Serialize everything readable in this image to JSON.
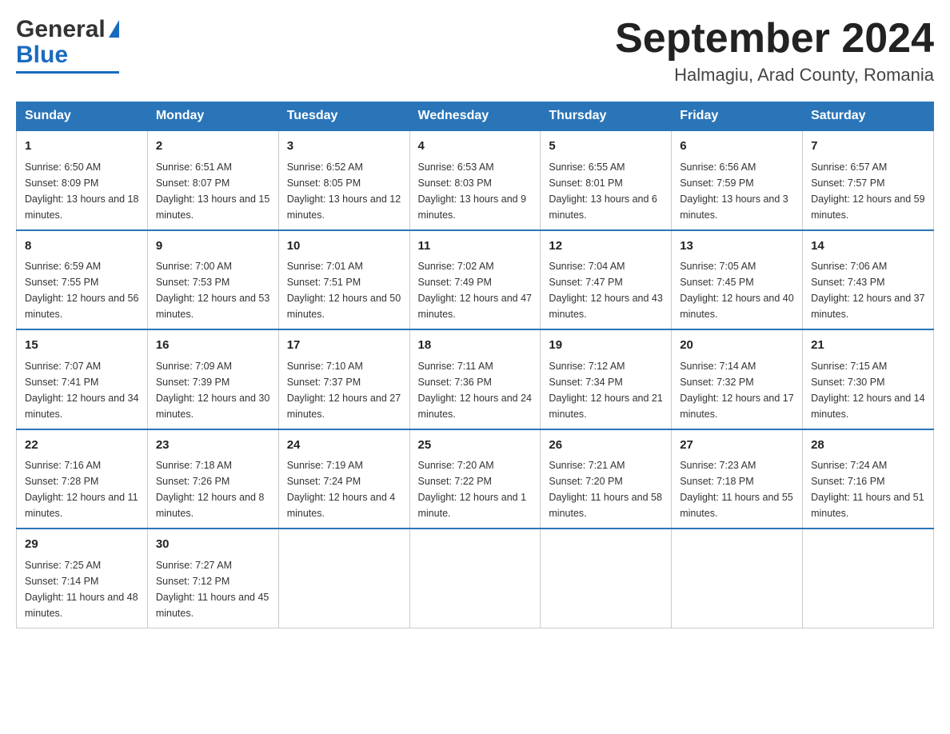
{
  "header": {
    "logo_general": "General",
    "logo_blue": "Blue",
    "title": "September 2024",
    "subtitle": "Halmagiu, Arad County, Romania"
  },
  "weekdays": [
    "Sunday",
    "Monday",
    "Tuesday",
    "Wednesday",
    "Thursday",
    "Friday",
    "Saturday"
  ],
  "weeks": [
    [
      {
        "day": "1",
        "sunrise": "Sunrise: 6:50 AM",
        "sunset": "Sunset: 8:09 PM",
        "daylight": "Daylight: 13 hours and 18 minutes."
      },
      {
        "day": "2",
        "sunrise": "Sunrise: 6:51 AM",
        "sunset": "Sunset: 8:07 PM",
        "daylight": "Daylight: 13 hours and 15 minutes."
      },
      {
        "day": "3",
        "sunrise": "Sunrise: 6:52 AM",
        "sunset": "Sunset: 8:05 PM",
        "daylight": "Daylight: 13 hours and 12 minutes."
      },
      {
        "day": "4",
        "sunrise": "Sunrise: 6:53 AM",
        "sunset": "Sunset: 8:03 PM",
        "daylight": "Daylight: 13 hours and 9 minutes."
      },
      {
        "day": "5",
        "sunrise": "Sunrise: 6:55 AM",
        "sunset": "Sunset: 8:01 PM",
        "daylight": "Daylight: 13 hours and 6 minutes."
      },
      {
        "day": "6",
        "sunrise": "Sunrise: 6:56 AM",
        "sunset": "Sunset: 7:59 PM",
        "daylight": "Daylight: 13 hours and 3 minutes."
      },
      {
        "day": "7",
        "sunrise": "Sunrise: 6:57 AM",
        "sunset": "Sunset: 7:57 PM",
        "daylight": "Daylight: 12 hours and 59 minutes."
      }
    ],
    [
      {
        "day": "8",
        "sunrise": "Sunrise: 6:59 AM",
        "sunset": "Sunset: 7:55 PM",
        "daylight": "Daylight: 12 hours and 56 minutes."
      },
      {
        "day": "9",
        "sunrise": "Sunrise: 7:00 AM",
        "sunset": "Sunset: 7:53 PM",
        "daylight": "Daylight: 12 hours and 53 minutes."
      },
      {
        "day": "10",
        "sunrise": "Sunrise: 7:01 AM",
        "sunset": "Sunset: 7:51 PM",
        "daylight": "Daylight: 12 hours and 50 minutes."
      },
      {
        "day": "11",
        "sunrise": "Sunrise: 7:02 AM",
        "sunset": "Sunset: 7:49 PM",
        "daylight": "Daylight: 12 hours and 47 minutes."
      },
      {
        "day": "12",
        "sunrise": "Sunrise: 7:04 AM",
        "sunset": "Sunset: 7:47 PM",
        "daylight": "Daylight: 12 hours and 43 minutes."
      },
      {
        "day": "13",
        "sunrise": "Sunrise: 7:05 AM",
        "sunset": "Sunset: 7:45 PM",
        "daylight": "Daylight: 12 hours and 40 minutes."
      },
      {
        "day": "14",
        "sunrise": "Sunrise: 7:06 AM",
        "sunset": "Sunset: 7:43 PM",
        "daylight": "Daylight: 12 hours and 37 minutes."
      }
    ],
    [
      {
        "day": "15",
        "sunrise": "Sunrise: 7:07 AM",
        "sunset": "Sunset: 7:41 PM",
        "daylight": "Daylight: 12 hours and 34 minutes."
      },
      {
        "day": "16",
        "sunrise": "Sunrise: 7:09 AM",
        "sunset": "Sunset: 7:39 PM",
        "daylight": "Daylight: 12 hours and 30 minutes."
      },
      {
        "day": "17",
        "sunrise": "Sunrise: 7:10 AM",
        "sunset": "Sunset: 7:37 PM",
        "daylight": "Daylight: 12 hours and 27 minutes."
      },
      {
        "day": "18",
        "sunrise": "Sunrise: 7:11 AM",
        "sunset": "Sunset: 7:36 PM",
        "daylight": "Daylight: 12 hours and 24 minutes."
      },
      {
        "day": "19",
        "sunrise": "Sunrise: 7:12 AM",
        "sunset": "Sunset: 7:34 PM",
        "daylight": "Daylight: 12 hours and 21 minutes."
      },
      {
        "day": "20",
        "sunrise": "Sunrise: 7:14 AM",
        "sunset": "Sunset: 7:32 PM",
        "daylight": "Daylight: 12 hours and 17 minutes."
      },
      {
        "day": "21",
        "sunrise": "Sunrise: 7:15 AM",
        "sunset": "Sunset: 7:30 PM",
        "daylight": "Daylight: 12 hours and 14 minutes."
      }
    ],
    [
      {
        "day": "22",
        "sunrise": "Sunrise: 7:16 AM",
        "sunset": "Sunset: 7:28 PM",
        "daylight": "Daylight: 12 hours and 11 minutes."
      },
      {
        "day": "23",
        "sunrise": "Sunrise: 7:18 AM",
        "sunset": "Sunset: 7:26 PM",
        "daylight": "Daylight: 12 hours and 8 minutes."
      },
      {
        "day": "24",
        "sunrise": "Sunrise: 7:19 AM",
        "sunset": "Sunset: 7:24 PM",
        "daylight": "Daylight: 12 hours and 4 minutes."
      },
      {
        "day": "25",
        "sunrise": "Sunrise: 7:20 AM",
        "sunset": "Sunset: 7:22 PM",
        "daylight": "Daylight: 12 hours and 1 minute."
      },
      {
        "day": "26",
        "sunrise": "Sunrise: 7:21 AM",
        "sunset": "Sunset: 7:20 PM",
        "daylight": "Daylight: 11 hours and 58 minutes."
      },
      {
        "day": "27",
        "sunrise": "Sunrise: 7:23 AM",
        "sunset": "Sunset: 7:18 PM",
        "daylight": "Daylight: 11 hours and 55 minutes."
      },
      {
        "day": "28",
        "sunrise": "Sunrise: 7:24 AM",
        "sunset": "Sunset: 7:16 PM",
        "daylight": "Daylight: 11 hours and 51 minutes."
      }
    ],
    [
      {
        "day": "29",
        "sunrise": "Sunrise: 7:25 AM",
        "sunset": "Sunset: 7:14 PM",
        "daylight": "Daylight: 11 hours and 48 minutes."
      },
      {
        "day": "30",
        "sunrise": "Sunrise: 7:27 AM",
        "sunset": "Sunset: 7:12 PM",
        "daylight": "Daylight: 11 hours and 45 minutes."
      },
      null,
      null,
      null,
      null,
      null
    ]
  ]
}
